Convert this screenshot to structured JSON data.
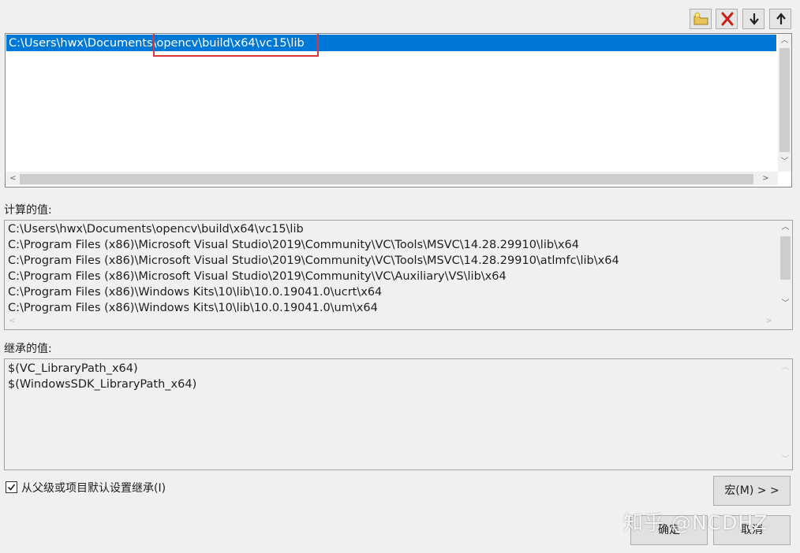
{
  "toolbar": {
    "buttons": [
      {
        "icon": "new-folder-icon"
      },
      {
        "icon": "delete-icon"
      },
      {
        "icon": "move-down-icon"
      },
      {
        "icon": "move-up-icon"
      }
    ]
  },
  "editor": {
    "selected_path": "C:\\Users\\hwx\\Documents\\opencv\\build\\x64\\vc15\\lib",
    "highlight_color": "#0078d7",
    "annotation_color": "#d9363e"
  },
  "evaluated": {
    "label": "计算的值:",
    "lines": [
      "C:\\Users\\hwx\\Documents\\opencv\\build\\x64\\vc15\\lib",
      "C:\\Program Files (x86)\\Microsoft Visual Studio\\2019\\Community\\VC\\Tools\\MSVC\\14.28.29910\\lib\\x64",
      "C:\\Program Files (x86)\\Microsoft Visual Studio\\2019\\Community\\VC\\Tools\\MSVC\\14.28.29910\\atlmfc\\lib\\x64",
      "C:\\Program Files (x86)\\Microsoft Visual Studio\\2019\\Community\\VC\\Auxiliary\\VS\\lib\\x64",
      "C:\\Program Files (x86)\\Windows Kits\\10\\lib\\10.0.19041.0\\ucrt\\x64",
      "C:\\Program Files (x86)\\Windows Kits\\10\\lib\\10.0.19041.0\\um\\x64"
    ]
  },
  "inherited": {
    "label": "继承的值:",
    "lines": [
      "$(VC_LibraryPath_x64)",
      "$(WindowsSDK_LibraryPath_x64)"
    ]
  },
  "inherit_checkbox": {
    "checked": true,
    "label": "从父级或项目默认设置继承(I)"
  },
  "buttons": {
    "macros": "宏(M) > >",
    "ok": "确定",
    "cancel": "取消"
  },
  "watermark": "知乎 @NCDHZ"
}
